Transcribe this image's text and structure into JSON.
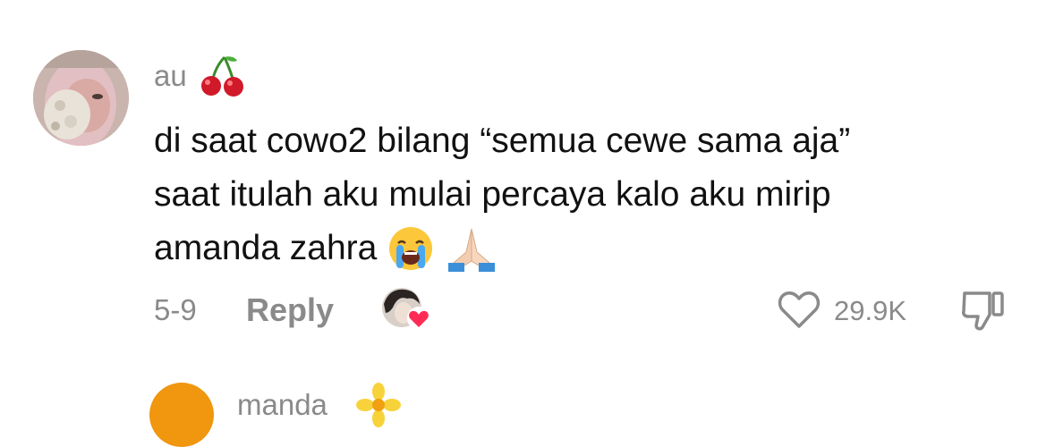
{
  "comment": {
    "username": "au",
    "username_emoji": "cherries",
    "text_lines": [
      "di saat cowo2 bilang “semua cewe sama aja”",
      "saat itulah aku mulai percaya kalo aku mirip",
      "amanda zahra"
    ],
    "trailing_emojis": [
      "loudly-crying-face",
      "folded-hands"
    ],
    "date": "5-9",
    "reply_label": "Reply",
    "like_count": "29.9K",
    "liked_by_creator": true
  },
  "next_comment": {
    "username_partial": "manda",
    "username_emoji": "blossom"
  },
  "colors": {
    "text": "#111111",
    "secondary": "#8a8a8a",
    "heart_badge": "#fe2c55"
  }
}
